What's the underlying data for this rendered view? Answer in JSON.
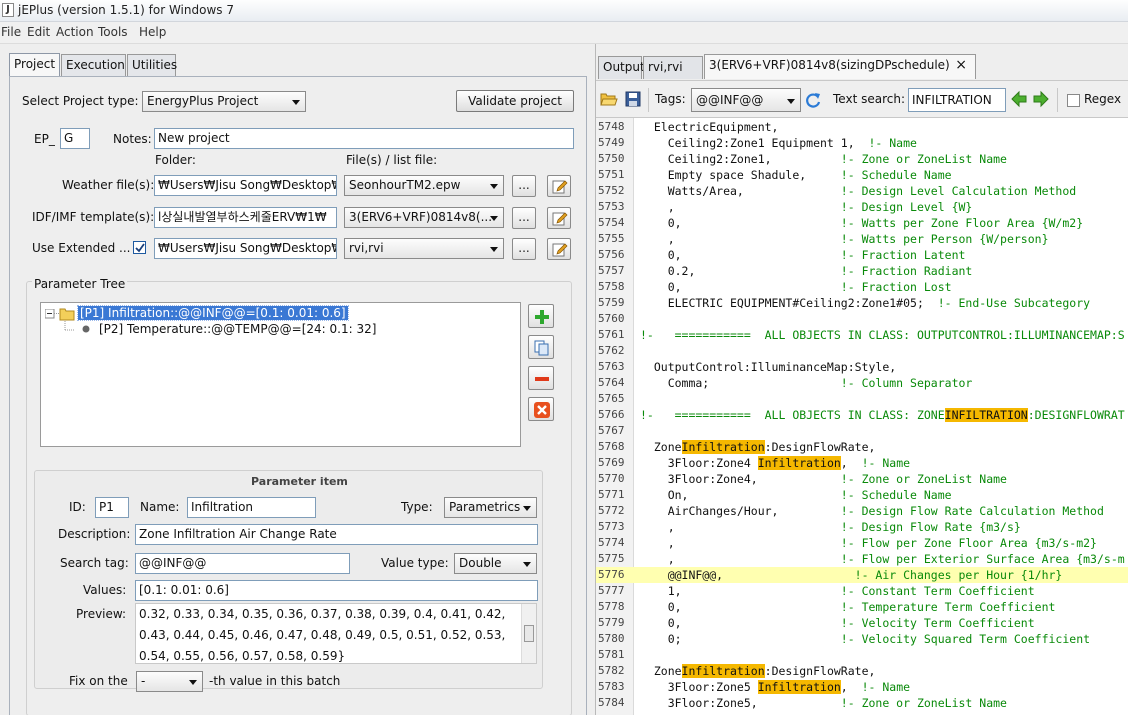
{
  "window": {
    "title": "jEPlus (version 1.5.1) for Windows 7",
    "icon": "java-cup-icon"
  },
  "menu": [
    "File",
    "Edit",
    "Action",
    "Tools",
    "Help"
  ],
  "left_tabs": [
    "Project",
    "Execution",
    "Utilities"
  ],
  "project": {
    "type_label": "Select Project type:",
    "type_value": "EnergyPlus Project",
    "validate_label": "Validate project",
    "ep_label": "EP_",
    "ep_value": "G",
    "notes_label": "Notes:",
    "notes_value": "New project",
    "folder_header": "Folder:",
    "files_header": "File(s) / list file:",
    "weather_label": "Weather file(s):",
    "weather_folder": "₩Users₩Jisu Song₩Desktop₩",
    "weather_file": "SeonhourTM2.epw",
    "idf_label": "IDF/IMF template(s):",
    "idf_folder": "l상실내발열부하스케줄ERV₩1₩",
    "idf_file": "3(ERV6+VRF)0814v8(...",
    "extended_label": "Use Extended ...",
    "extended_folder": "₩Users₩Jisu Song₩Desktop₩",
    "extended_file": "rvi,rvi",
    "browse_label": "...",
    "tree_title": "Parameter Tree",
    "tree_p1": "[P1] Infiltration::@@INF@@=[0.1: 0.01: 0.6]",
    "tree_p2": "[P2] Temperature::@@TEMP@@=[24: 0.1: 32]"
  },
  "param_item": {
    "title": "Parameter item",
    "id_label": "ID:",
    "id_value": "P1",
    "name_label": "Name:",
    "name_value": "Infiltration",
    "type_label": "Type:",
    "type_value": "Parametrics",
    "desc_label": "Description:",
    "desc_value": "Zone Infiltration Air Change Rate",
    "tag_label": "Search tag:",
    "tag_value": "@@INF@@",
    "vtype_label": "Value type:",
    "vtype_value": "Double",
    "values_label": "Values:",
    "values_value": "[0.1: 0.01: 0.6]",
    "preview_label": "Preview:",
    "preview_lines": [
      "0.32, 0.33, 0.34, 0.35, 0.36, 0.37, 0.38, 0.39, 0.4, 0.41, 0.42,",
      "0.43, 0.44, 0.45, 0.46, 0.47, 0.48, 0.49, 0.5, 0.51, 0.52, 0.53,",
      "0.54, 0.55, 0.56, 0.57, 0.58, 0.59}"
    ],
    "fix_label": "Fix on the",
    "fix_value": "-",
    "fix_suffix": "-th value in this batch"
  },
  "right_tabs": [
    "Output",
    "rvi,rvi",
    "3(ERV6+VRF)0814v8(sizingDPschedule)...."
  ],
  "close_glyph": "×",
  "toolbar": {
    "tags_label": "Tags:",
    "tags_value": "@@INF@@",
    "search_label": "Text search:",
    "search_value": "INFILTRATION",
    "regex_label": "Regex"
  },
  "code_lines": [
    {
      "n": "5748",
      "t": "  ElectricEquipment,",
      "c": ""
    },
    {
      "n": "5749",
      "t": "    Ceiling2:Zone1 Equipment 1,  ",
      "c": "!- Name"
    },
    {
      "n": "5750",
      "t": "    Ceiling2:Zone1,          ",
      "c": "!- Zone or ZoneList Name"
    },
    {
      "n": "5751",
      "t": "    Empty space Shadule,     ",
      "c": "!- Schedule Name"
    },
    {
      "n": "5752",
      "t": "    Watts/Area,              ",
      "c": "!- Design Level Calculation Method"
    },
    {
      "n": "5753",
      "t": "    ,                        ",
      "c": "!- Design Level {W}"
    },
    {
      "n": "5754",
      "t": "    0,                       ",
      "c": "!- Watts per Zone Floor Area {W/m2}"
    },
    {
      "n": "5755",
      "t": "    ,                        ",
      "c": "!- Watts per Person {W/person}"
    },
    {
      "n": "5756",
      "t": "    0,                       ",
      "c": "!- Fraction Latent"
    },
    {
      "n": "5757",
      "t": "    0.2,                     ",
      "c": "!- Fraction Radiant"
    },
    {
      "n": "5758",
      "t": "    0,                       ",
      "c": "!- Fraction Lost"
    },
    {
      "n": "5759",
      "t": "    ELECTRIC EQUIPMENT#Ceiling2:Zone1#05;  ",
      "c": "!- End-Use Subcategory"
    },
    {
      "n": "5760",
      "t": "",
      "c": ""
    },
    {
      "n": "5761",
      "t": "",
      "c": "!-   ===========  ALL OBJECTS IN CLASS: OUTPUTCONTROL:ILLUMINANCEMAP:S"
    },
    {
      "n": "5762",
      "t": "",
      "c": ""
    },
    {
      "n": "5763",
      "t": "  OutputControl:IlluminanceMap:Style,",
      "c": ""
    },
    {
      "n": "5764",
      "t": "    Comma;                   ",
      "c": "!- Column Separator"
    },
    {
      "n": "5765",
      "t": "",
      "c": ""
    },
    {
      "n": "5766",
      "t": "",
      "c": "!-   ===========  ALL OBJECTS IN CLASS: ZONE",
      "h": "INFILTRATION",
      "c2": ":DESIGNFLOWRAT"
    },
    {
      "n": "5767",
      "t": "",
      "c": ""
    },
    {
      "n": "5768",
      "t": "  Zone",
      "h": "Infiltration",
      "t2": ":DesignFlowRate,",
      "c": ""
    },
    {
      "n": "5769",
      "t": "    3Floor:Zone4 ",
      "h": "Infiltration",
      "t2": ",  ",
      "c": "!- Name"
    },
    {
      "n": "5770",
      "t": "    3Floor:Zone4,            ",
      "c": "!- Zone or ZoneList Name"
    },
    {
      "n": "5771",
      "t": "    On,                      ",
      "c": "!- Schedule Name"
    },
    {
      "n": "5772",
      "t": "    AirChanges/Hour,         ",
      "c": "!- Design Flow Rate Calculation Method"
    },
    {
      "n": "5773",
      "t": "    ,                        ",
      "c": "!- Design Flow Rate {m3/s}"
    },
    {
      "n": "5774",
      "t": "    ,                        ",
      "c": "!- Flow per Zone Floor Area {m3/s-m2}"
    },
    {
      "n": "5775",
      "t": "    ,                        ",
      "c": "!- Flow per Exterior Surface Area {m3/s-m"
    },
    {
      "n": "5776",
      "t": "    @@INF@@,                   ",
      "c": "!- Air Changes per Hour {1/hr}",
      "cur": true
    },
    {
      "n": "5777",
      "t": "    1,                       ",
      "c": "!- Constant Term Coefficient"
    },
    {
      "n": "5778",
      "t": "    0,                       ",
      "c": "!- Temperature Term Coefficient"
    },
    {
      "n": "5779",
      "t": "    0,                       ",
      "c": "!- Velocity Term Coefficient"
    },
    {
      "n": "5780",
      "t": "    0;                       ",
      "c": "!- Velocity Squared Term Coefficient"
    },
    {
      "n": "5781",
      "t": "",
      "c": ""
    },
    {
      "n": "5782",
      "t": "  Zone",
      "h": "Infiltration",
      "t2": ":DesignFlowRate,",
      "c": ""
    },
    {
      "n": "5783",
      "t": "    3Floor:Zone5 ",
      "h": "Infiltration",
      "t2": ",  ",
      "c": "!- Name"
    },
    {
      "n": "5784",
      "t": "    3Floor:Zone5,            ",
      "c": "!- Zone or ZoneList Name"
    }
  ]
}
